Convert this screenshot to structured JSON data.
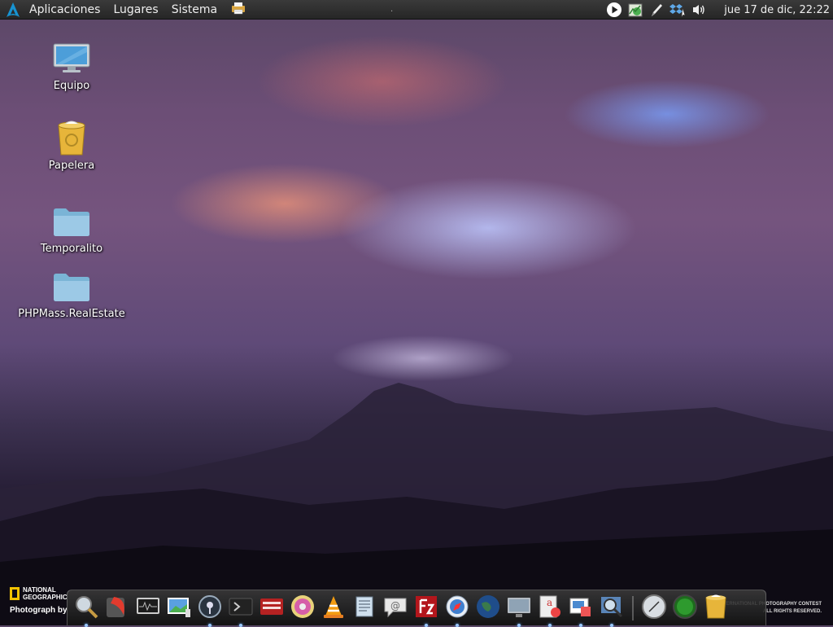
{
  "top_panel": {
    "menus": [
      "Aplicaciones",
      "Lugares",
      "Sistema"
    ],
    "separator": ".",
    "clock": "jue 17 de dic, 22:22",
    "tray_icons": [
      "play-icon",
      "network-monitor-icon",
      "pen-icon",
      "dropbox-icon",
      "volume-icon"
    ]
  },
  "desktop": {
    "icons": [
      {
        "label": "Equipo",
        "icon": "computer-icon"
      },
      {
        "label": "Papelera",
        "icon": "trash-icon"
      },
      {
        "label": "Temporalito",
        "icon": "folder-icon"
      },
      {
        "label": "PHPMass.RealEstate",
        "icon": "folder-icon"
      }
    ]
  },
  "dock": {
    "items": [
      "search-icon",
      "app-icon",
      "system-monitor-icon",
      "image-viewer-icon",
      "audio-icon",
      "terminal-icon",
      "panel-icon",
      "disc-icon",
      "vlc-icon",
      "files-icon",
      "mail-icon",
      "filezilla-icon",
      "browser-icon",
      "globe-icon",
      "display-icon",
      "text-editor-icon",
      "presentation-icon",
      "image-search-icon",
      "clock-icon",
      "green-orb-icon",
      "trash-icon"
    ]
  },
  "watermark": {
    "brand_line1": "NATIONAL",
    "brand_line2": "GEOGRAPHIC",
    "credit": "Photograph by",
    "contest_line1": "INTERNATIONAL PHOTOGRAPHY CONTEST",
    "contest_line2": "ALL RIGHTS RESERVED."
  }
}
